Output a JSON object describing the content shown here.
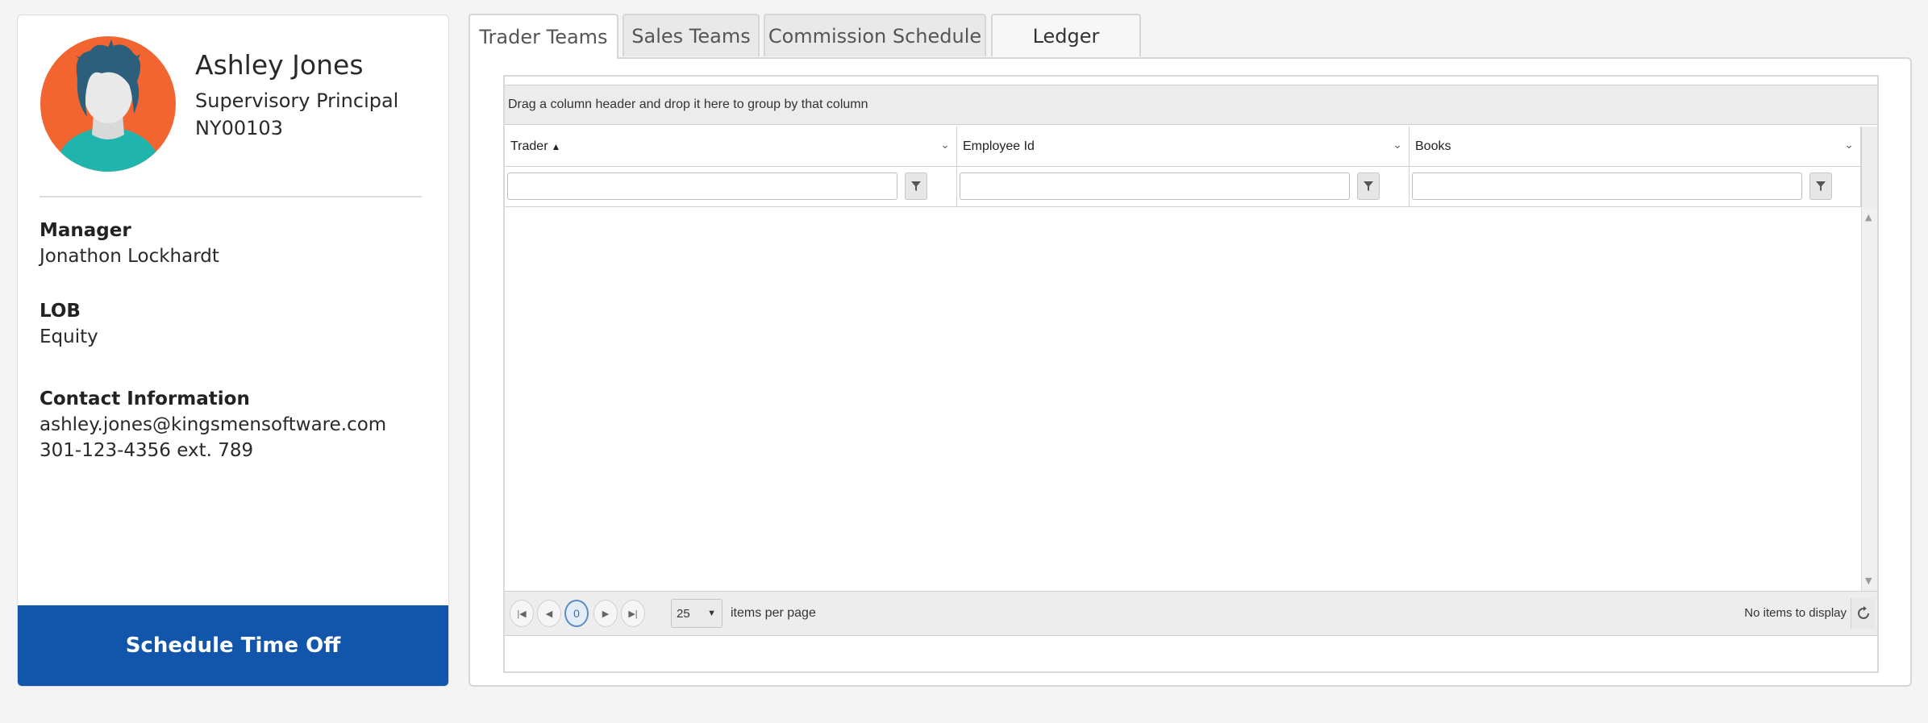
{
  "profile": {
    "name": "Ashley Jones",
    "title": "Supervisory Principal",
    "id": "NY00103",
    "manager_label": "Manager",
    "manager_value": "Jonathon Lockhardt",
    "lob_label": "LOB",
    "lob_value": "Equity",
    "contact_label": "Contact Information",
    "email": "ashley.jones@kingsmensoftware.com",
    "phone": "301-123-4356 ext. 789",
    "schedule_button": "Schedule Time Off"
  },
  "tabs": [
    {
      "label": "Trader Teams",
      "active": true
    },
    {
      "label": "Sales Teams",
      "active": false
    },
    {
      "label": "Commission Schedule",
      "active": false
    },
    {
      "label": "Ledger",
      "active": false
    }
  ],
  "grid": {
    "group_hint": "Drag a column header and drop it here to group by that column",
    "columns": [
      {
        "label": "Trader",
        "sort": "ascending"
      },
      {
        "label": "Employee Id"
      },
      {
        "label": "Books"
      }
    ],
    "pager": {
      "current_page": "0",
      "page_size": "25",
      "items_per_page_label": "items per page",
      "status": "No items to display"
    }
  },
  "colors": {
    "accent_blue": "#1256ab",
    "avatar_bg": "#f26530",
    "avatar_shirt": "#1fb5ad",
    "avatar_hair": "#2c5f7c"
  }
}
